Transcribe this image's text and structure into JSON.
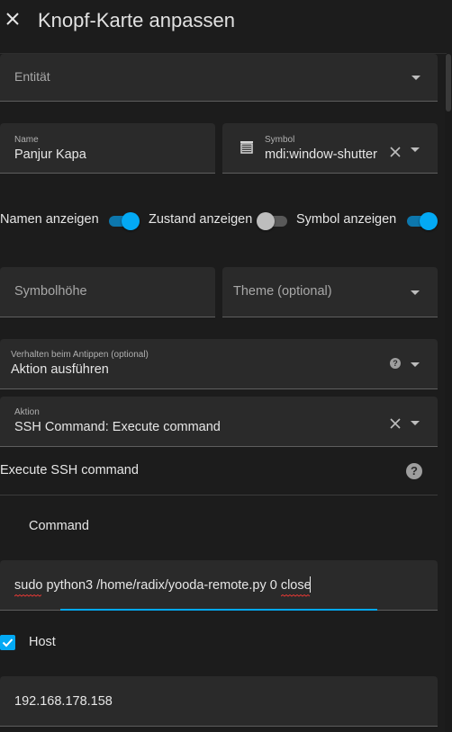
{
  "header": {
    "title": "Knopf-Karte anpassen",
    "close_icon": "close-icon"
  },
  "entity": {
    "label": "Entität"
  },
  "name_field": {
    "label": "Name",
    "value": "Panjur Kapa"
  },
  "symbol_field": {
    "label": "Symbol",
    "value": "mdi:window-shutter",
    "icon": "window-shutter-icon"
  },
  "toggles": [
    {
      "label": "Namen anzeigen",
      "on": true
    },
    {
      "label": "Zustand anzeigen",
      "on": false
    },
    {
      "label": "Symbol anzeigen",
      "on": true
    }
  ],
  "icon_height": {
    "placeholder": "Symbolhöhe"
  },
  "theme": {
    "placeholder": "Theme (optional)"
  },
  "tap_action": {
    "label": "Verhalten beim Antippen (optional)",
    "value": "Aktion ausführen"
  },
  "action": {
    "label": "Aktion",
    "value": "SSH Command: Execute command"
  },
  "ssh": {
    "title": "Execute SSH command",
    "command_label": "Command",
    "command_value": "sudo python3 /home/radix/yooda-remote.py 0 close",
    "host_label": "Host",
    "host_checked": true,
    "host_value": "192.168.178.158"
  },
  "colors": {
    "accent": "#03a9f4",
    "background": "#1c1c1c",
    "field": "#2a2a2a",
    "spell_error": "#e53935"
  }
}
